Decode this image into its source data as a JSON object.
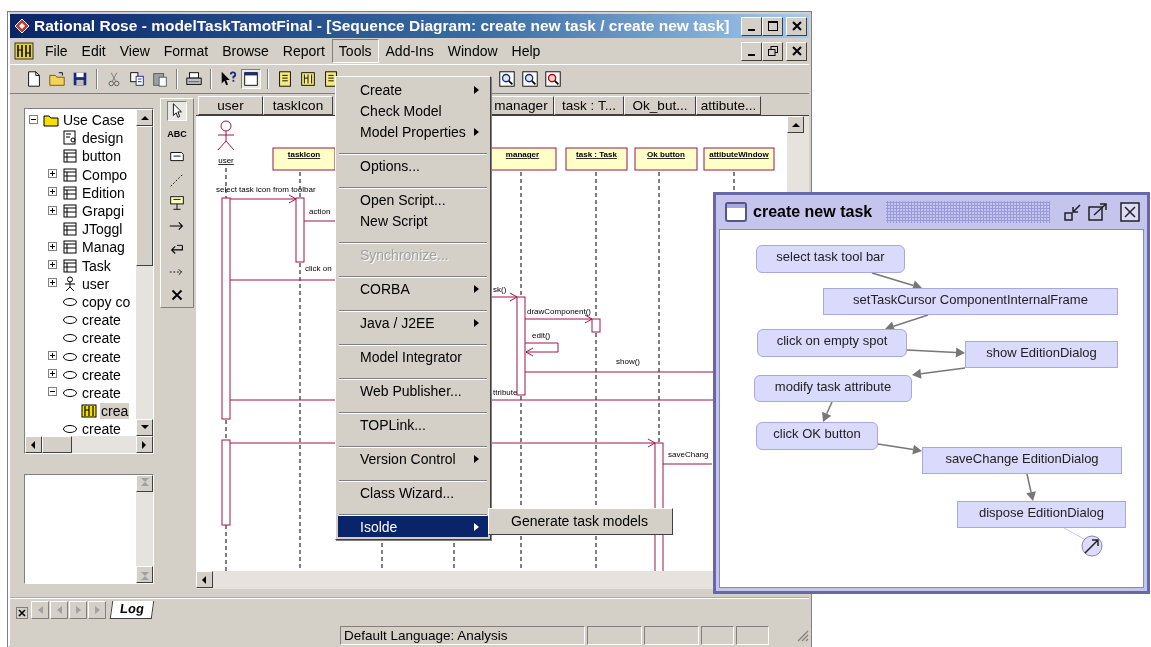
{
  "window": {
    "title": "Rational Rose - modelTaskTamotFinal - [Sequence Diagram: create new task / create new task]"
  },
  "menu_bar": [
    {
      "label": "File",
      "selected": false
    },
    {
      "label": "Edit",
      "selected": false
    },
    {
      "label": "View",
      "selected": false
    },
    {
      "label": "Format",
      "selected": false
    },
    {
      "label": "Browse",
      "selected": false
    },
    {
      "label": "Report",
      "selected": false
    },
    {
      "label": "Tools",
      "selected": true
    },
    {
      "label": "Add-Ins",
      "selected": false
    },
    {
      "label": "Window",
      "selected": false
    },
    {
      "label": "Help",
      "selected": false
    }
  ],
  "toolbar": {
    "left": [
      {
        "kind": "new",
        "selected": false
      },
      {
        "kind": "open",
        "selected": false
      },
      {
        "kind": "save",
        "selected": false
      },
      {
        "kind": "separator"
      },
      {
        "kind": "cut",
        "selected": false
      },
      {
        "kind": "copy",
        "selected": false
      },
      {
        "kind": "paste",
        "selected": false
      },
      {
        "kind": "separator"
      },
      {
        "kind": "print",
        "selected": false
      },
      {
        "kind": "separator"
      },
      {
        "kind": "help",
        "selected": false
      },
      {
        "kind": "browse",
        "selected": true
      },
      {
        "kind": "separator"
      },
      {
        "kind": "doc",
        "selected": false
      },
      {
        "kind": "diagram",
        "selected": false
      },
      {
        "kind": "doc",
        "selected": false
      }
    ],
    "right": [
      {
        "kind": "zoom",
        "selected": false
      },
      {
        "kind": "zoom",
        "selected": false
      },
      {
        "kind": "zoom-fit",
        "selected": false
      }
    ]
  },
  "tools_menu": {
    "items": [
      {
        "kind": "item",
        "label": "Create",
        "submenu": true,
        "disabled": false,
        "selected": false
      },
      {
        "kind": "item",
        "label": "Check Model",
        "submenu": false,
        "disabled": false,
        "selected": false
      },
      {
        "kind": "item",
        "label": "Model Properties",
        "submenu": true,
        "disabled": false,
        "selected": false
      },
      {
        "kind": "separator"
      },
      {
        "kind": "item",
        "label": "Options...",
        "submenu": false,
        "disabled": false,
        "selected": false
      },
      {
        "kind": "separator"
      },
      {
        "kind": "item",
        "label": "Open Script...",
        "submenu": false,
        "disabled": false,
        "selected": false
      },
      {
        "kind": "item",
        "label": "New Script",
        "submenu": false,
        "disabled": false,
        "selected": false
      },
      {
        "kind": "separator"
      },
      {
        "kind": "item",
        "label": "Synchronize...",
        "submenu": false,
        "disabled": true,
        "selected": false
      },
      {
        "kind": "separator"
      },
      {
        "kind": "item",
        "label": "CORBA",
        "submenu": true,
        "disabled": false,
        "selected": false
      },
      {
        "kind": "separator"
      },
      {
        "kind": "item",
        "label": "Java / J2EE",
        "submenu": true,
        "disabled": false,
        "selected": false
      },
      {
        "kind": "separator"
      },
      {
        "kind": "item",
        "label": "Model Integrator",
        "submenu": false,
        "disabled": false,
        "selected": false
      },
      {
        "kind": "separator"
      },
      {
        "kind": "item",
        "label": "Web Publisher...",
        "submenu": false,
        "disabled": false,
        "selected": false
      },
      {
        "kind": "separator"
      },
      {
        "kind": "item",
        "label": "TOPLink...",
        "submenu": false,
        "disabled": false,
        "selected": false
      },
      {
        "kind": "separator"
      },
      {
        "kind": "item",
        "label": "Version Control",
        "submenu": true,
        "disabled": false,
        "selected": false
      },
      {
        "kind": "separator"
      },
      {
        "kind": "item",
        "label": "Class Wizard...",
        "submenu": false,
        "disabled": false,
        "selected": false
      },
      {
        "kind": "separator"
      },
      {
        "kind": "item",
        "label": "Isolde",
        "submenu": true,
        "disabled": false,
        "selected": true
      }
    ]
  },
  "submenu": {
    "items": [
      {
        "label": "Generate task models",
        "selected": false
      }
    ]
  },
  "browser_tree": [
    {
      "label": "Use Case",
      "kind": "folder",
      "expanded": true,
      "selected": false,
      "children": [
        {
          "label": "design",
          "kind": "diagram",
          "selected": false
        },
        {
          "label": "button",
          "kind": "class",
          "selected": false
        },
        {
          "label": "Compo",
          "kind": "class",
          "expanded": false,
          "selected": false
        },
        {
          "label": "Edition",
          "kind": "class",
          "expanded": false,
          "selected": false
        },
        {
          "label": "Grapgi",
          "kind": "class",
          "expanded": false,
          "selected": false
        },
        {
          "label": "JToggl",
          "kind": "class",
          "selected": false
        },
        {
          "label": "Manag",
          "kind": "class",
          "expanded": false,
          "selected": false
        },
        {
          "label": "Task",
          "kind": "class",
          "expanded": false,
          "selected": false
        },
        {
          "label": "user",
          "kind": "actor",
          "expanded": false,
          "selected": false
        },
        {
          "label": "copy co",
          "kind": "usecase",
          "selected": false
        },
        {
          "label": "create",
          "kind": "usecase",
          "selected": false
        },
        {
          "label": "create",
          "kind": "usecase",
          "selected": false
        },
        {
          "label": "create",
          "kind": "usecase",
          "expanded": false,
          "selected": false
        },
        {
          "label": "create",
          "kind": "usecase",
          "expanded": false,
          "selected": false
        },
        {
          "label": "create",
          "kind": "usecase",
          "expanded": true,
          "selected": false,
          "children": [
            {
              "label": "crea",
              "kind": "sequence",
              "selected": true
            }
          ]
        },
        {
          "label": "create",
          "kind": "usecase",
          "selected": false
        }
      ]
    }
  ],
  "palette": [
    {
      "kind": "pointer",
      "selected": true
    },
    {
      "kind": "text",
      "label": "ABC",
      "selected": false
    },
    {
      "kind": "note",
      "selected": false
    },
    {
      "kind": "anchor",
      "selected": false
    },
    {
      "kind": "object",
      "selected": false
    },
    {
      "kind": "message",
      "selected": false
    },
    {
      "kind": "return",
      "selected": false
    },
    {
      "kind": "async",
      "selected": false
    },
    {
      "kind": "destroy",
      "selected": false
    }
  ],
  "diagram": {
    "columns": [
      "user",
      "taskIcon",
      "manager",
      "task : T...",
      "Ok_but...",
      "attibute..."
    ],
    "actor": "user",
    "objects": [
      "taskIcon",
      "manager",
      "task : Task",
      "Ok button",
      "attibuteWindow"
    ],
    "messages": [
      "select task icon from toolbar",
      "action",
      "click on",
      "sk()",
      "drawComponent()",
      "edit()",
      "show()",
      "ttribute",
      "saveChang"
    ]
  },
  "log_tabs": [
    {
      "label": "Log",
      "selected": true
    }
  ],
  "status_bar": {
    "text": "Default Language: Analysis"
  },
  "task_window": {
    "title": "create new task",
    "nodes": [
      {
        "label": "select task tool bar",
        "kind": "user"
      },
      {
        "label": "setTaskCursor ComponentInternalFrame",
        "kind": "system"
      },
      {
        "label": "click on empty spot",
        "kind": "user"
      },
      {
        "label": "show EditionDialog",
        "kind": "system"
      },
      {
        "label": "modify task attribute",
        "kind": "user"
      },
      {
        "label": "click OK button",
        "kind": "user"
      },
      {
        "label": "saveChange EditionDialog",
        "kind": "system"
      },
      {
        "label": "dispose EditionDialog",
        "kind": "system"
      }
    ]
  }
}
